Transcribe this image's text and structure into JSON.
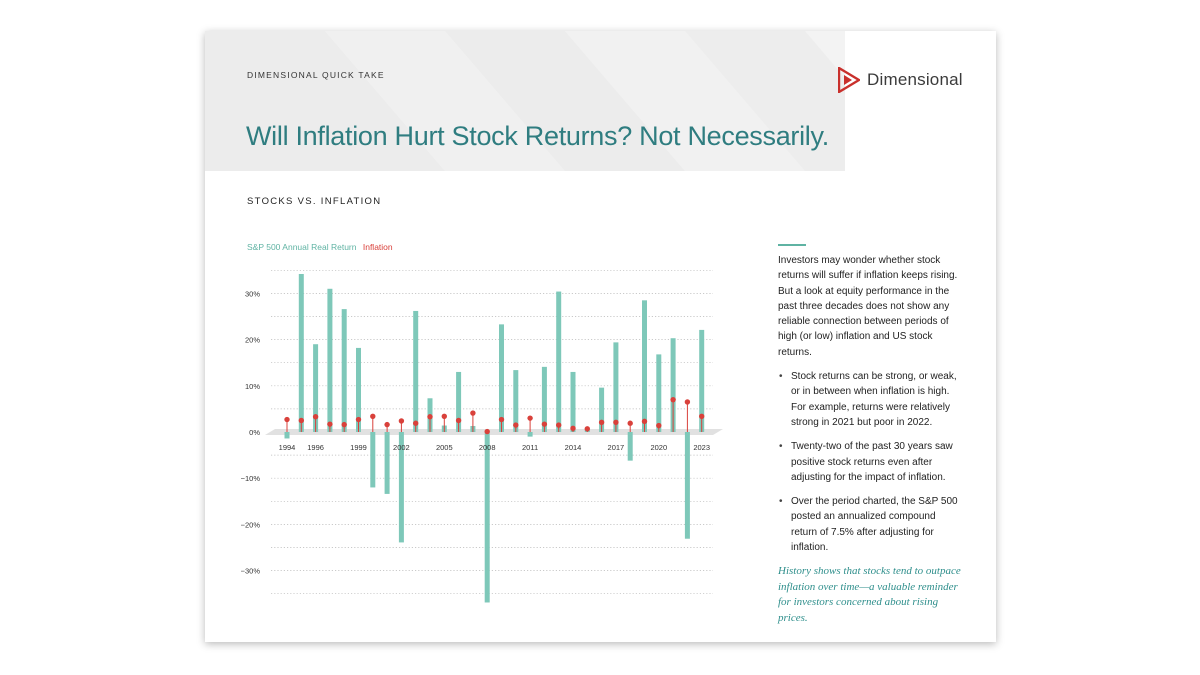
{
  "header": {
    "eyebrow": "DIMENSIONAL QUICK TAKE",
    "brand": "Dimensional",
    "title": "Will Inflation Hurt Stock Returns? Not Necessarily.",
    "section": "STOCKS VS. INFLATION"
  },
  "legend": {
    "series1": "S&P 500 Annual Real Return",
    "series2": "Inflation"
  },
  "colors": {
    "teal": "#7ec8b9",
    "red": "#d9413b",
    "title": "#2f7d80",
    "logo": "#c9302c"
  },
  "chart_data": {
    "type": "bar",
    "x": [
      1994,
      1995,
      1996,
      1997,
      1998,
      1999,
      2000,
      2001,
      2002,
      2003,
      2004,
      2005,
      2006,
      2007,
      2008,
      2009,
      2010,
      2011,
      2012,
      2013,
      2014,
      2015,
      2016,
      2017,
      2018,
      2019,
      2020,
      2021,
      2022,
      2023
    ],
    "ylim": [
      -37,
      36
    ],
    "yticks": [
      30,
      20,
      10,
      0,
      -10,
      -20,
      -30
    ],
    "ytick_labels": [
      "30%",
      "20%",
      "10%",
      "0%",
      "−10%",
      "−20%",
      "−30%"
    ],
    "xtick_labels": [
      "1994",
      "1996",
      "1999",
      "2002",
      "2005",
      "2008",
      "2011",
      "2014",
      "2017",
      "2020",
      "2023"
    ],
    "series": [
      {
        "name": "S&P 500 Annual Real Return",
        "values": [
          -1.4,
          34.2,
          19.0,
          31.0,
          26.6,
          18.2,
          -12.0,
          -13.4,
          -23.9,
          26.2,
          7.3,
          1.4,
          13.0,
          1.3,
          -36.9,
          23.3,
          13.4,
          -1.0,
          14.1,
          30.4,
          13.0,
          0.6,
          9.6,
          19.4,
          -6.2,
          28.5,
          16.8,
          20.3,
          -23.1,
          22.1
        ]
      },
      {
        "name": "Inflation",
        "values": [
          2.7,
          2.5,
          3.3,
          1.7,
          1.6,
          2.7,
          3.4,
          1.6,
          2.4,
          1.9,
          3.3,
          3.4,
          2.5,
          4.1,
          0.1,
          2.7,
          1.5,
          3.0,
          1.7,
          1.5,
          0.8,
          0.7,
          2.1,
          2.1,
          1.9,
          2.3,
          1.4,
          7.0,
          6.5,
          3.4
        ]
      }
    ]
  },
  "sidebar": {
    "intro": "Investors may wonder whether stock returns will suffer if inflation keeps rising. But a look at equity performance in the past three decades does not show any reliable connection between periods of high (or low) inflation and US stock returns.",
    "bullets": [
      "Stock returns can be strong, or weak, or in between when inflation is high. For example, returns were relatively strong in 2021 but poor in 2022.",
      "Twenty-two of the past 30 years saw positive stock returns even after adjusting for the impact of inflation.",
      "Over the period charted, the S&P 500 posted an annualized compound return of 7.5% after adjusting for inflation."
    ],
    "quote": "History shows that stocks tend to outpace inflation over time—a valuable reminder for investors concerned about rising prices."
  }
}
